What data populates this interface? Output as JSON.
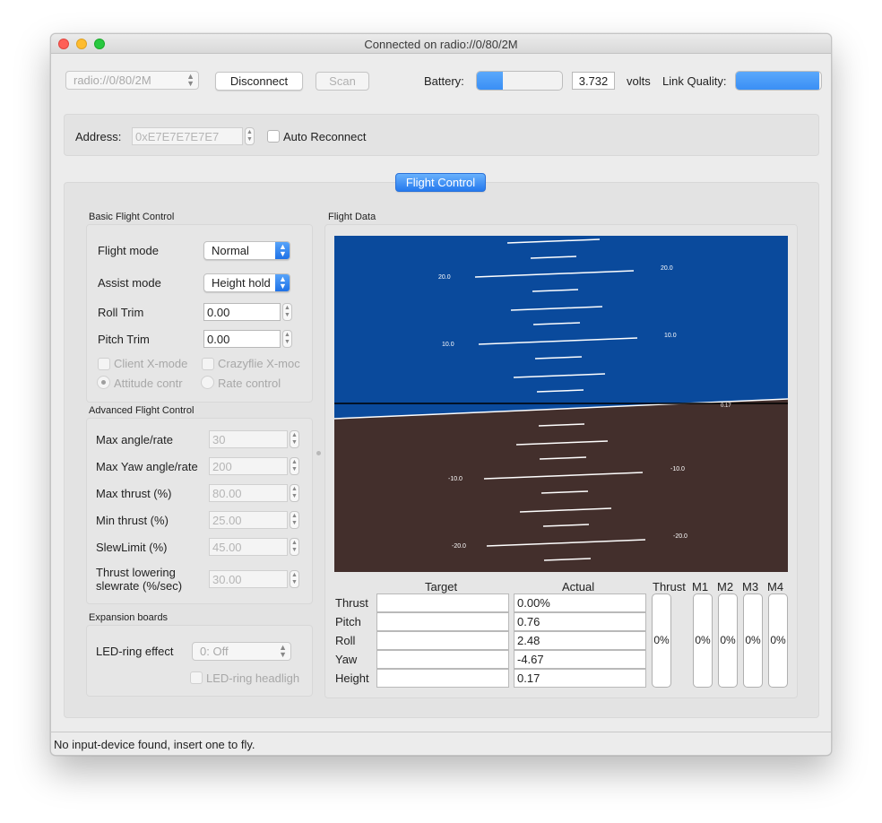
{
  "window": {
    "title": "Connected on radio://0/80/2M"
  },
  "toolbar": {
    "uri_value": "radio://0/80/2M",
    "disconnect_label": "Disconnect",
    "scan_label": "Scan",
    "battery_label": "Battery:",
    "battery_level": 0.3,
    "battery_voltage": "3.732",
    "volts_label": "volts",
    "link_quality_label": "Link Quality:",
    "link_quality_level": 0.98
  },
  "address": {
    "label": "Address:",
    "value": "0xE7E7E7E7E7",
    "auto_reconnect_label": "Auto Reconnect"
  },
  "tab": {
    "label": "Flight Control"
  },
  "basic": {
    "title": "Basic Flight Control",
    "flight_mode_label": "Flight mode",
    "flight_mode_value": "Normal",
    "assist_mode_label": "Assist mode",
    "assist_mode_value": "Height hold",
    "roll_trim_label": "Roll Trim",
    "roll_trim_value": "0.00",
    "pitch_trim_label": "Pitch Trim",
    "pitch_trim_value": "0.00",
    "client_xmode_label": "Client X-mode",
    "crazyflie_xmode_label": "Crazyflie X-moc",
    "attitude_label": "Attitude contr",
    "rate_label": "Rate control"
  },
  "advanced": {
    "title": "Advanced Flight Control",
    "rows": [
      {
        "label": "Max angle/rate",
        "value": "30"
      },
      {
        "label": "Max Yaw angle/rate",
        "value": "200"
      },
      {
        "label": "Max thrust (%)",
        "value": "80.00"
      },
      {
        "label": "Min thrust (%)",
        "value": "25.00"
      },
      {
        "label": "SlewLimit (%)",
        "value": "45.00"
      }
    ],
    "thrust_lowering_line1": "Thrust lowering",
    "thrust_lowering_line2": "slewrate (%/sec)",
    "thrust_lowering_value": "30.00"
  },
  "expansion": {
    "title": "Expansion boards",
    "led_effect_label": "LED-ring effect",
    "led_effect_value": "0: Off",
    "led_headlight_label": "LED-ring headligh"
  },
  "flight_data": {
    "title": "Flight Data",
    "horizon": {
      "sky_color": "#0a4a9c",
      "ground_color": "#432f2c",
      "labels": {
        "l20": "20.0",
        "r20": "20.0",
        "l10": "10.0",
        "r10": "10.0",
        "lm10": "-10.0",
        "rm10": "-10.0",
        "lm20": "-20.0",
        "rm20": "-20.0",
        "height": "0.17"
      }
    },
    "target_header": "Target",
    "actual_header": "Actual",
    "rows": [
      {
        "label": "Thrust",
        "target": "",
        "actual": "0.00%"
      },
      {
        "label": "Pitch",
        "target": "",
        "actual": "0.76"
      },
      {
        "label": "Roll",
        "target": "",
        "actual": "2.48"
      },
      {
        "label": "Yaw",
        "target": "",
        "actual": "-4.67"
      },
      {
        "label": "Height",
        "target": "",
        "actual": "0.17"
      }
    ],
    "bars": [
      {
        "label": "Thrust",
        "value": "0%"
      },
      {
        "label": "M1",
        "value": "0%"
      },
      {
        "label": "M2",
        "value": "0%"
      },
      {
        "label": "M3",
        "value": "0%"
      },
      {
        "label": "M4",
        "value": "0%"
      }
    ]
  },
  "status": {
    "message": "No input-device found, insert one to fly."
  }
}
